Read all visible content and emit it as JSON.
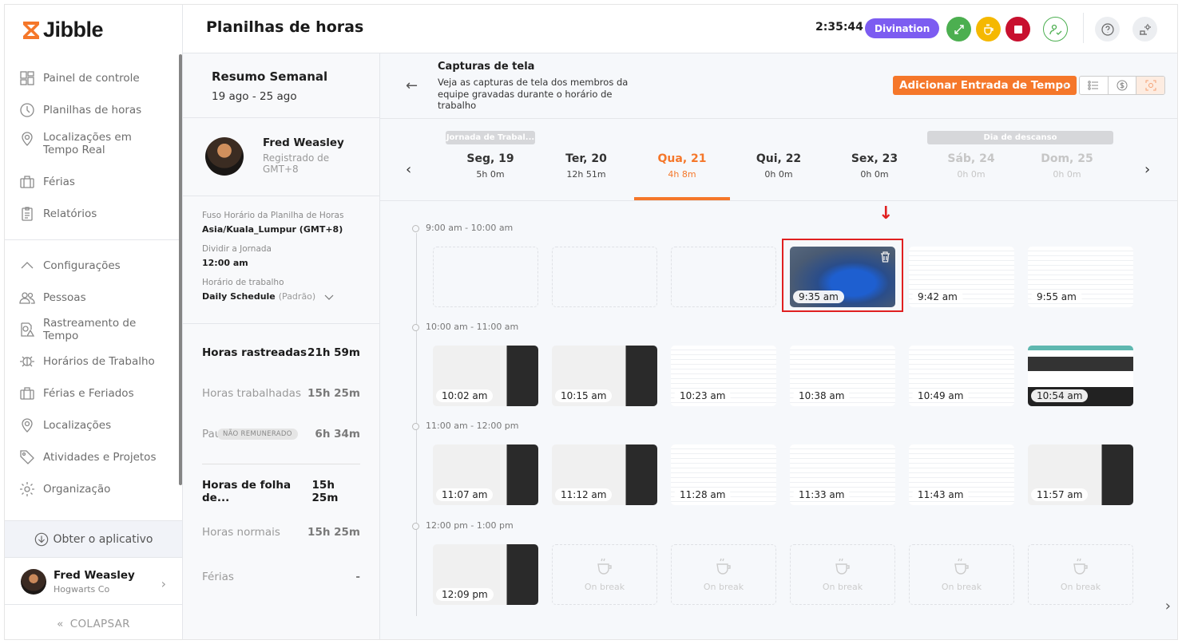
{
  "app": {
    "name": "Jibble"
  },
  "sidebar": {
    "items": [
      {
        "label": "Painel de controle",
        "icon": "dashboard-icon"
      },
      {
        "label": "Planilhas de horas",
        "icon": "clock-icon"
      },
      {
        "label": "Localizações em Tempo Real",
        "icon": "location-pin-icon"
      },
      {
        "label": "Férias",
        "icon": "suitcase-icon"
      },
      {
        "label": "Relatórios",
        "icon": "clipboard-icon"
      }
    ],
    "settings_label": "Configurações",
    "settings_items": [
      {
        "label": "Pessoas",
        "icon": "people-icon"
      },
      {
        "label": "Rastreamento de Tempo",
        "icon": "time-tracking-icon"
      },
      {
        "label": "Horários de Trabalho",
        "icon": "work-schedule-icon"
      },
      {
        "label": "Férias e Feriados",
        "icon": "suitcase-icon"
      },
      {
        "label": "Localizações",
        "icon": "location-pin-icon"
      },
      {
        "label": "Atividades e Projetos",
        "icon": "tag-icon"
      },
      {
        "label": "Organização",
        "icon": "gear-icon"
      }
    ],
    "get_app": "Obter o aplicativo",
    "user": {
      "name": "Fred Weasley",
      "org": "Hogwarts Co"
    },
    "collapse": "COLAPSAR"
  },
  "header": {
    "title": "Planilhas de horas",
    "clock": "2:35:44",
    "activity": "Divination",
    "colors": {
      "activity": "#7c5cf1",
      "switch": "#4caf50",
      "break": "#f5b800",
      "stop": "#c8102e",
      "accent": "#f5772a"
    }
  },
  "summary": {
    "title": "Resumo Semanal",
    "range": "19 ago - 25 ago",
    "member": {
      "name": "Fred Weasley",
      "sub": "Registrado de GMT+8"
    },
    "timezone_label": "Fuso Horário da Planilha de Horas",
    "timezone": "Asia/Kuala_Lumpur (GMT+8)",
    "split_label": "Dividir a Jornada",
    "split": "12:00 am",
    "schedule_label": "Horário de trabalho",
    "schedule": "Daily Schedule",
    "schedule_note": "(Padrão)",
    "stats": [
      {
        "label": "Horas rastreadas",
        "value": "21h 59m"
      },
      {
        "label": "Horas trabalhadas",
        "value": "15h 25m"
      },
      {
        "label": "Pau...",
        "badge": "NÃO REMUNERADO",
        "value": "6h 34m"
      },
      {
        "label": "Horas de folha de...",
        "value": "15h 25m"
      },
      {
        "label": "Horas normais",
        "value": "15h 25m"
      },
      {
        "label": "Férias",
        "value": "-"
      }
    ]
  },
  "content": {
    "title": "Capturas de tela",
    "description": "Veja as capturas de tela dos membros da equipe gravadas durante o horário de trabalho",
    "add_button": "Adicionar Entrada de Tempo",
    "tags": {
      "workday": "Jornada de Trabal...",
      "rest": "Dia de descanso"
    },
    "days": [
      {
        "name": "Seg, 19",
        "hours": "5h 0m"
      },
      {
        "name": "Ter, 20",
        "hours": "12h 51m"
      },
      {
        "name": "Qua, 21",
        "hours": "4h 8m",
        "active": true
      },
      {
        "name": "Qui, 22",
        "hours": "0h 0m"
      },
      {
        "name": "Sex, 23",
        "hours": "0h 0m"
      },
      {
        "name": "Sáb, 24",
        "hours": "0h 0m",
        "off": true
      },
      {
        "name": "Dom, 25",
        "hours": "0h 0m",
        "off": true
      }
    ],
    "groups": [
      {
        "label": "9:00 am - 10:00 am",
        "shots": [
          {
            "type": "empty"
          },
          {
            "type": "empty"
          },
          {
            "type": "empty"
          },
          {
            "type": "desktop",
            "time": "9:35 am",
            "highlighted": true
          },
          {
            "type": "mail",
            "time": "9:42 am"
          },
          {
            "type": "mail",
            "time": "9:55 am"
          }
        ]
      },
      {
        "label": "10:00 am - 11:00 am",
        "shots": [
          {
            "type": "meet",
            "time": "10:02 am"
          },
          {
            "type": "meet",
            "time": "10:15 am"
          },
          {
            "type": "mail",
            "time": "10:23 am"
          },
          {
            "type": "mail",
            "time": "10:38 am"
          },
          {
            "type": "mail",
            "time": "10:49 am"
          },
          {
            "type": "img",
            "time": "10:54 am"
          }
        ]
      },
      {
        "label": "11:00 am - 12:00 pm",
        "shots": [
          {
            "type": "meet",
            "time": "11:07 am"
          },
          {
            "type": "meet",
            "time": "11:12 am"
          },
          {
            "type": "mail",
            "time": "11:28 am"
          },
          {
            "type": "mail",
            "time": "11:33 am"
          },
          {
            "type": "mail",
            "time": "11:43 am"
          },
          {
            "type": "meet",
            "time": "11:57 am"
          }
        ]
      },
      {
        "label": "12:00 pm - 1:00 pm",
        "shots": [
          {
            "type": "meet",
            "time": "12:09 pm"
          },
          {
            "type": "break",
            "text": "On break"
          },
          {
            "type": "break",
            "text": "On break"
          },
          {
            "type": "break",
            "text": "On break"
          },
          {
            "type": "break",
            "text": "On break"
          },
          {
            "type": "break",
            "text": "On break"
          }
        ]
      }
    ]
  }
}
